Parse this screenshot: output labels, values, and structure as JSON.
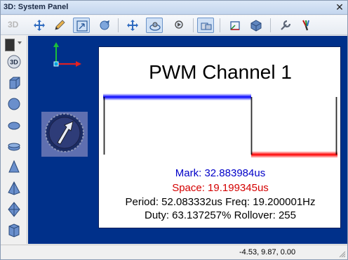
{
  "window": {
    "title": "3D: System Panel",
    "close_glyph": "✕"
  },
  "toolbar": {
    "mode_label": "3D",
    "tools": [
      {
        "name": "move-icon",
        "active": false
      },
      {
        "name": "pencil-icon",
        "active": false
      },
      {
        "name": "resize-icon",
        "active": true
      },
      {
        "name": "rotate-icon",
        "active": false
      },
      {
        "name": "pan-icon",
        "active": false
      },
      {
        "name": "orbit-icon",
        "active": true
      },
      {
        "name": "zoom-icon",
        "active": false
      },
      {
        "name": "panel-icon",
        "active": true
      },
      {
        "name": "frame-icon",
        "active": false
      },
      {
        "name": "cube-view-icon",
        "active": false
      },
      {
        "name": "wrench-icon",
        "active": false
      },
      {
        "name": "paint-icon",
        "active": false
      }
    ]
  },
  "leftbar": {
    "view_3d_label": "3D",
    "shapes": [
      "cube-icon",
      "sphere-icon",
      "ellipsoid-icon",
      "disc-icon",
      "cone-icon",
      "pyramid-icon",
      "octahedron-icon",
      "prism-icon"
    ]
  },
  "panel": {
    "title": "PWM Channel 1",
    "mark": "Mark: 32.883984us",
    "space": "Space: 19.199345us",
    "period_line": "Period: 52.083332us  Freq: 19.200001Hz",
    "duty_line": "Duty: 63.137257%  Rollover: 255"
  },
  "pwm": {
    "duty_fraction": 0.63137257,
    "mark_color": "#0000ff",
    "space_color": "#ff0000"
  },
  "status": {
    "coords": "-4.53, 9.87, 0.00"
  },
  "colors": {
    "canvas": "#00308a",
    "accent": "#6a93c9"
  }
}
